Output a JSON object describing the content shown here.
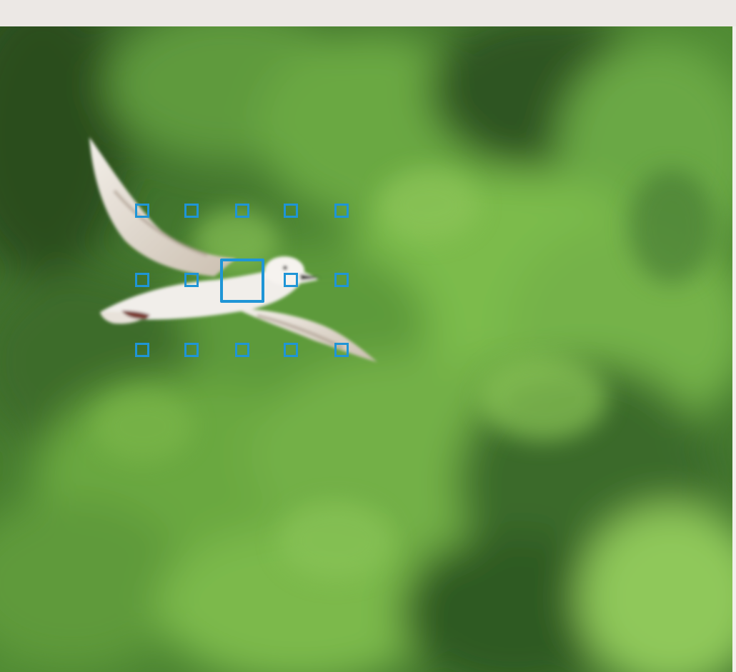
{
  "scene": {
    "subject": "gull-in-flight",
    "background": "blurred-green-foliage"
  },
  "af_overlay": {
    "color": "#1f95d6",
    "grid_columns": 5,
    "grid_rows": 3,
    "active_point": "center"
  },
  "colors": {
    "frame_border": "#ece8e5",
    "foliage_dark": "#2f5a22",
    "foliage_light": "#7fba4a"
  }
}
